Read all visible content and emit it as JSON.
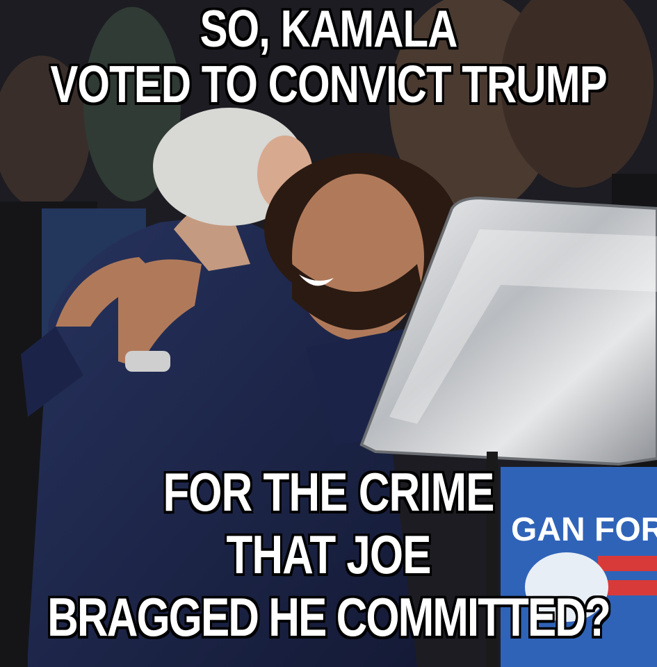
{
  "meme": {
    "top_caption": [
      "SO, KAMALA",
      "VOTED TO CONVICT TRUMP"
    ],
    "bottom_caption": [
      "FOR THE CRIME",
      "THAT JOE",
      "BRAGGED HE COMMITTED?"
    ],
    "sign_text": "GAN FOR"
  },
  "colors": {
    "suit": "#1f2a52",
    "skin": "#b07a5a",
    "hair_white": "#d8d8d4",
    "hair_dark": "#2a1a12",
    "sign": "#2f63b8",
    "prompter_glass": "#c9ccd0",
    "caption_text": "#ffffff",
    "caption_outline": "#000000"
  }
}
